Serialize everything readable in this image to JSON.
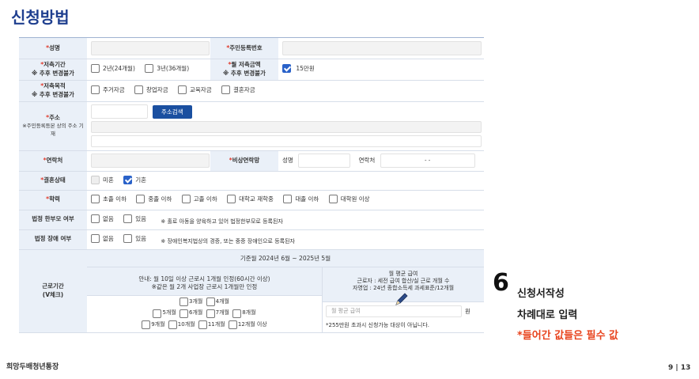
{
  "title": "신청방법",
  "rows": {
    "name": {
      "label": "성명"
    },
    "rrn": {
      "label": "주민등록번호"
    },
    "period": {
      "label": "저축기간",
      "sub": "※ 추후 변경불가",
      "options": [
        "2년(24개월)",
        "3년(36개월)"
      ]
    },
    "monthly": {
      "label": "월 저축금액",
      "sub": "※ 추후 변경불가",
      "value": "15만원"
    },
    "purpose": {
      "label": "저축목적",
      "sub": "※ 추후 변경불가",
      "options": [
        "주거자금",
        "창업자금",
        "교육자금",
        "결혼자금"
      ]
    },
    "address": {
      "label": "주소",
      "sub": "※주민등록등본 상의 주소 기재",
      "button": "주소검색"
    },
    "contact": {
      "label": "연락처"
    },
    "emergency": {
      "label": "비상연락망",
      "name_label": "성명",
      "phone_label": "연락처",
      "phone_value": "-          -"
    },
    "marital": {
      "label": "결혼상태",
      "options": [
        "미혼",
        "기혼"
      ]
    },
    "education": {
      "label": "학력",
      "options": [
        "초졸 이하",
        "중졸 이하",
        "고졸 이하",
        "대학교 재학중",
        "대졸 이하",
        "대학원 이상"
      ]
    },
    "single_parent": {
      "label": "법정 한부모 여부",
      "options": [
        "없음",
        "있음"
      ],
      "note": "※ 홀로 아동을 양육하고 있어 법정한부모로 등록된자"
    },
    "disability": {
      "label": "법정 장애 여부",
      "options": [
        "없음",
        "있음"
      ],
      "note": "※ 장애인복지법상의 경증, 또는 중증 장애인으로 등록된자"
    },
    "work": {
      "label": "근로기간",
      "sub": "(V체크)",
      "period_header": "기준월 2024년 6월 ~ 2025년 5월",
      "guide1": "안내: 월 10일 이상 근로시 1개월 인정(60시간 이상)",
      "guide2": "※같은 월 2개 사업장 근로시 1개월만 인정",
      "avg_title": "월 평균 급여",
      "avg_line1": "근로자 : 세전 급여 합산/실 근로 개월 수",
      "avg_line2": "자영업 : 24년 종합소득세 과세표준/12개월",
      "months_row1": [
        "3개월",
        "4개월"
      ],
      "months_row2": [
        "5개월",
        "6개월",
        "7개월",
        "8개월"
      ],
      "months_row3": [
        "9개월",
        "10개월",
        "11개월",
        "12개월 이상"
      ],
      "avg_placeholder": "월 평균 급여",
      "avg_unit": "원",
      "avg_note": "*255만원 초과시 신청가능 대상이 아닙니다."
    }
  },
  "side": {
    "step_number": "6",
    "step_title": "신청서작성",
    "line1": "차례대로 입력",
    "line2": "*들어간 값들은 필수 값"
  },
  "footer": {
    "left": "희망두배청년통장",
    "right": "9 | 13"
  },
  "colors": {
    "title": "#1f3f8f",
    "label_bg": "#eaf0f8",
    "checkbox_on": "#2a62c9",
    "button": "#1a4fa0",
    "required": "#e0392b",
    "highlight": "#e8431d"
  }
}
